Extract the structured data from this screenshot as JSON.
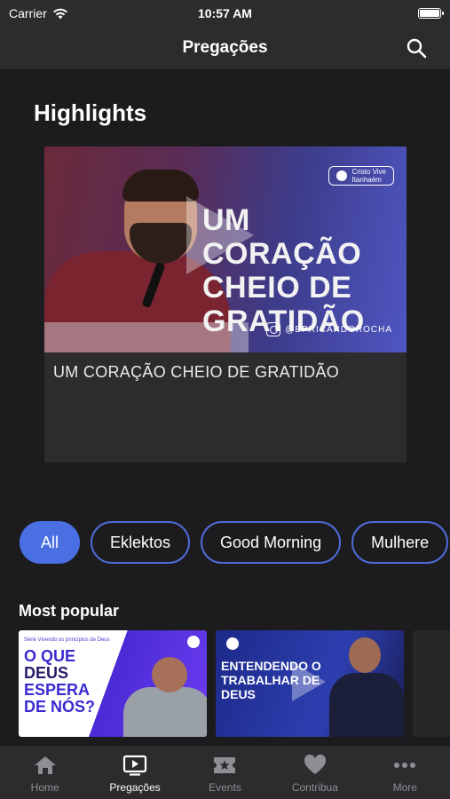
{
  "status_bar": {
    "carrier": "Carrier",
    "time": "10:57 AM"
  },
  "nav": {
    "title": "Pregações"
  },
  "highlights": {
    "title": "Highlights",
    "card": {
      "image_text": [
        "UM CORAÇÃO",
        "CHEIO DE",
        "GRATIDÃO"
      ],
      "logo_text": [
        "Cristo Vive",
        "Itanhaém"
      ],
      "handle": "@BPRICARDOROCHA",
      "caption": "UM CORAÇÃO CHEIO DE GRATIDÃO"
    }
  },
  "filters": {
    "chips": [
      {
        "label": "All",
        "active": true
      },
      {
        "label": "Eklektos",
        "active": false
      },
      {
        "label": "Good Morning",
        "active": false
      },
      {
        "label": "Mulhere",
        "active": false
      }
    ]
  },
  "most_popular": {
    "title": "Most popular",
    "cards": [
      {
        "top_text": "Série Vivendo os princípios de Deus",
        "lines": [
          "O QUE",
          "DEUS",
          "ESPERA",
          "DE NÓS?"
        ]
      },
      {
        "lines": [
          "ENTENDENDO O",
          "TRABALHAR DE",
          "DEUS"
        ]
      }
    ]
  },
  "tab_bar": {
    "tabs": [
      {
        "label": "Home",
        "icon": "home-icon",
        "active": false
      },
      {
        "label": "Pregações",
        "icon": "tv-play-icon",
        "active": true
      },
      {
        "label": "Events",
        "icon": "ticket-star-icon",
        "active": false
      },
      {
        "label": "Contribua",
        "icon": "heart-icon",
        "active": false
      },
      {
        "label": "More",
        "icon": "more-dots-icon",
        "active": false
      }
    ]
  },
  "colors": {
    "accent": "#4a6fe3",
    "background": "#1c1c1e",
    "bar": "#2c2c2e"
  }
}
